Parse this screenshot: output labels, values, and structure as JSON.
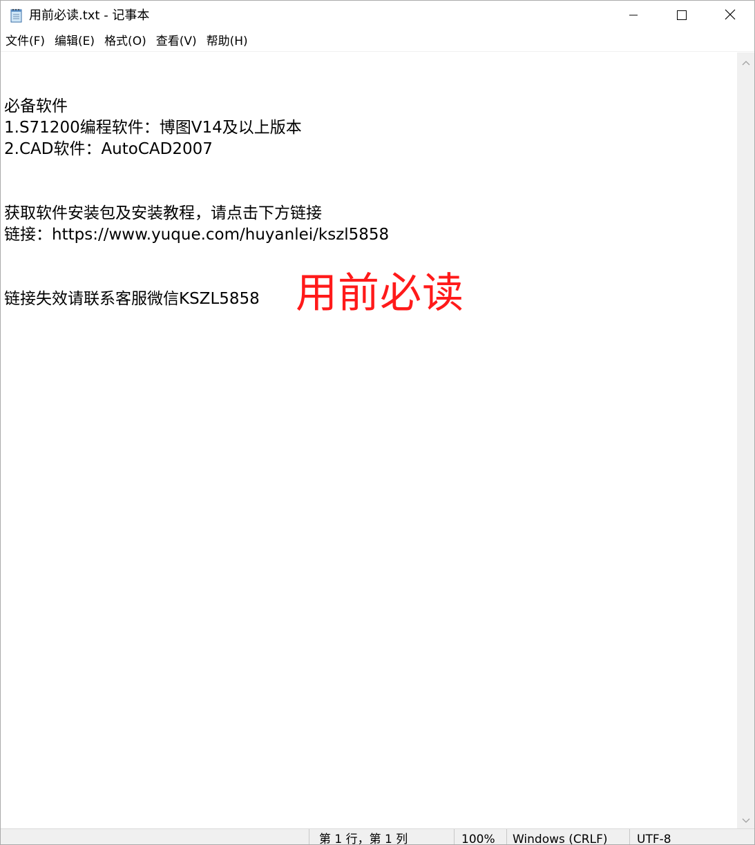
{
  "window": {
    "title": "用前必读.txt - 记事本"
  },
  "icons": {
    "app": "notepad-icon",
    "minimize": "minimize-icon",
    "maximize": "maximize-icon",
    "close": "close-icon",
    "scroll_up": "chevron-up-icon",
    "scroll_down": "chevron-down-icon"
  },
  "menu": {
    "items": [
      {
        "label": "文件(F)"
      },
      {
        "label": "编辑(E)"
      },
      {
        "label": "格式(O)"
      },
      {
        "label": "查看(V)"
      },
      {
        "label": "帮助(H)"
      }
    ]
  },
  "document": {
    "lines": [
      "必备软件",
      "1.S71200编程软件：博图V14及以上版本",
      "2.CAD软件：AutoCAD2007",
      "获取软件安装包及安装教程，请点击下方链接",
      "链接：https://www.yuque.com/huyanlei/kszl5858",
      "链接失效请联系客服微信KSZL5858"
    ],
    "overlay_title": "用前必读",
    "overlay_color": "#ff1a1a"
  },
  "status": {
    "position": "第 1 行，第 1 列",
    "zoom": "100%",
    "line_ending": "Windows (CRLF)",
    "encoding": "UTF-8"
  }
}
